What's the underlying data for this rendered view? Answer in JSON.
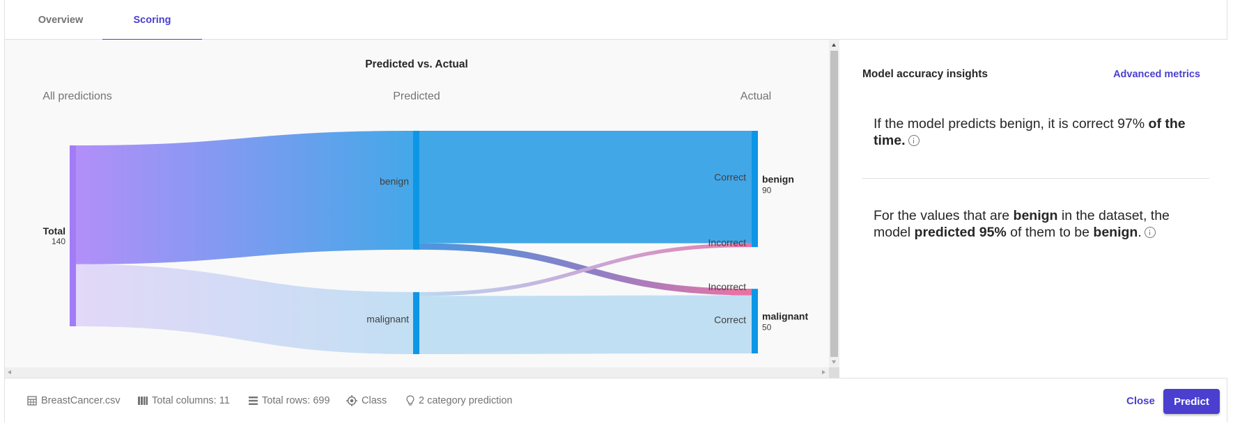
{
  "tabs": [
    {
      "label": "Overview",
      "active": false
    },
    {
      "label": "Scoring",
      "active": true
    }
  ],
  "chart_data": {
    "type": "sankey",
    "title": "Predicted vs. Actual",
    "column_labels": [
      "All predictions",
      "Predicted",
      "Actual"
    ],
    "root": {
      "label": "Total",
      "value": 140
    },
    "predicted": [
      {
        "label": "benign",
        "value": 92
      },
      {
        "label": "malignant",
        "value": 48
      }
    ],
    "actual": [
      {
        "label": "benign",
        "value": 90
      },
      {
        "label": "malignant",
        "value": 50
      }
    ],
    "flows": [
      {
        "from": "benign",
        "to": "benign",
        "label": "Correct",
        "value": 87
      },
      {
        "from": "benign",
        "to": "malignant",
        "label": "Incorrect",
        "value": 5
      },
      {
        "from": "malignant",
        "to": "benign",
        "label": "Incorrect",
        "value": 3
      },
      {
        "from": "malignant",
        "to": "malignant",
        "label": "Correct",
        "value": 45
      }
    ],
    "colors": {
      "root_node": "#a27cf7",
      "predicted_node": "#0d96e6",
      "actual_node": "#0d96e6",
      "benign_flow_from": "#b28ff8",
      "benign_flow_to": "#44a8e8",
      "malignant_flow_from": "#e2d8f8",
      "malignant_flow_to": "#c2dff3",
      "correct_benign": "#42a7e7",
      "correct_malignant": "#c0dff3",
      "incorrect": "#e872a3"
    }
  },
  "panel": {
    "title": "Model accuracy insights",
    "link": "Advanced metrics",
    "insight1": {
      "text1": "If the model predicts benign, it is correct 97% ",
      "bold1": "of the time."
    },
    "insight2": {
      "text1": "For the values that are ",
      "bold1": "benign",
      "text2": " in the dataset, the model ",
      "bold2": "predicted 95%",
      "text3": " of them to be ",
      "bold3": "benign",
      "text4": "."
    }
  },
  "footer": {
    "file": "BreastCancer.csv",
    "columns": "Total columns: 11",
    "rows": "Total rows: 699",
    "target": "Class",
    "prediction_type": "2 category prediction",
    "close_label": "Close",
    "predict_label": "Predict"
  }
}
